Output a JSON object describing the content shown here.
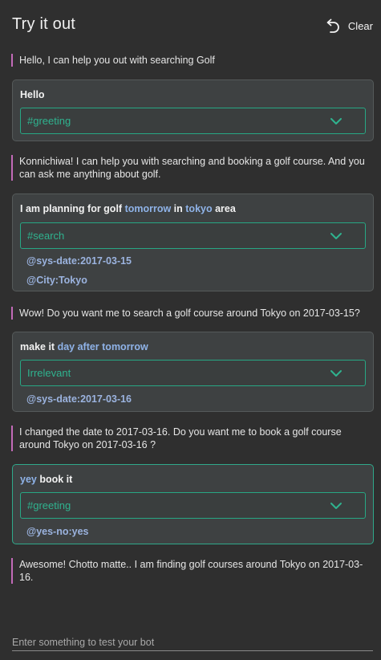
{
  "header": {
    "title": "Try it out",
    "clear_label": "Clear"
  },
  "messages": [
    {
      "type": "bot",
      "text": "Hello, I can help you out with searching Golf"
    },
    {
      "type": "user",
      "utterance": [
        {
          "t": "Hello",
          "hl": false
        }
      ],
      "intent": "#greeting",
      "entities": []
    },
    {
      "type": "bot",
      "text": "Konnichiwa! I can help you with searching and booking a golf course. And you can ask me anything about golf."
    },
    {
      "type": "user",
      "utterance": [
        {
          "t": "I am planning for golf ",
          "hl": false
        },
        {
          "t": "tomorrow",
          "hl": true
        },
        {
          "t": " in ",
          "hl": false
        },
        {
          "t": "tokyo",
          "hl": true
        },
        {
          "t": " area",
          "hl": false
        }
      ],
      "intent": "#search",
      "entities": [
        "@sys-date:2017-03-15",
        "@City:Tokyo"
      ]
    },
    {
      "type": "bot",
      "text": "Wow! Do you want me to search a golf course around Tokyo on 2017-03-15?"
    },
    {
      "type": "user",
      "utterance": [
        {
          "t": "make it ",
          "hl": false
        },
        {
          "t": "day after tomorrow",
          "hl": true
        }
      ],
      "intent": "Irrelevant",
      "entities": [
        "@sys-date:2017-03-16"
      ]
    },
    {
      "type": "bot",
      "text": "I changed the date to 2017-03-16. Do you want me to book a golf course around Tokyo on 2017-03-16 ?"
    },
    {
      "type": "user",
      "active": true,
      "utterance": [
        {
          "t": "yey",
          "hl": true
        },
        {
          "t": " book it",
          "hl": false
        }
      ],
      "intent": "#greeting",
      "entities": [
        "@yes-no:yes"
      ]
    },
    {
      "type": "bot",
      "text": "Awesome! Chotto matte.. I am finding golf courses around Tokyo on 2017-03-16."
    }
  ],
  "input": {
    "placeholder": "Enter something to test your bot",
    "value": ""
  },
  "colors": {
    "background": "#2f2f2f",
    "card": "#3e4142",
    "intent_accent": "#27a784",
    "entity": "#9bb3df",
    "highlight": "#8fb3e8",
    "bot_bar": "#c26ab8"
  },
  "icons": {
    "clear": "undo-arrow-icon",
    "intent_dropdown": "chevron-down-icon"
  }
}
